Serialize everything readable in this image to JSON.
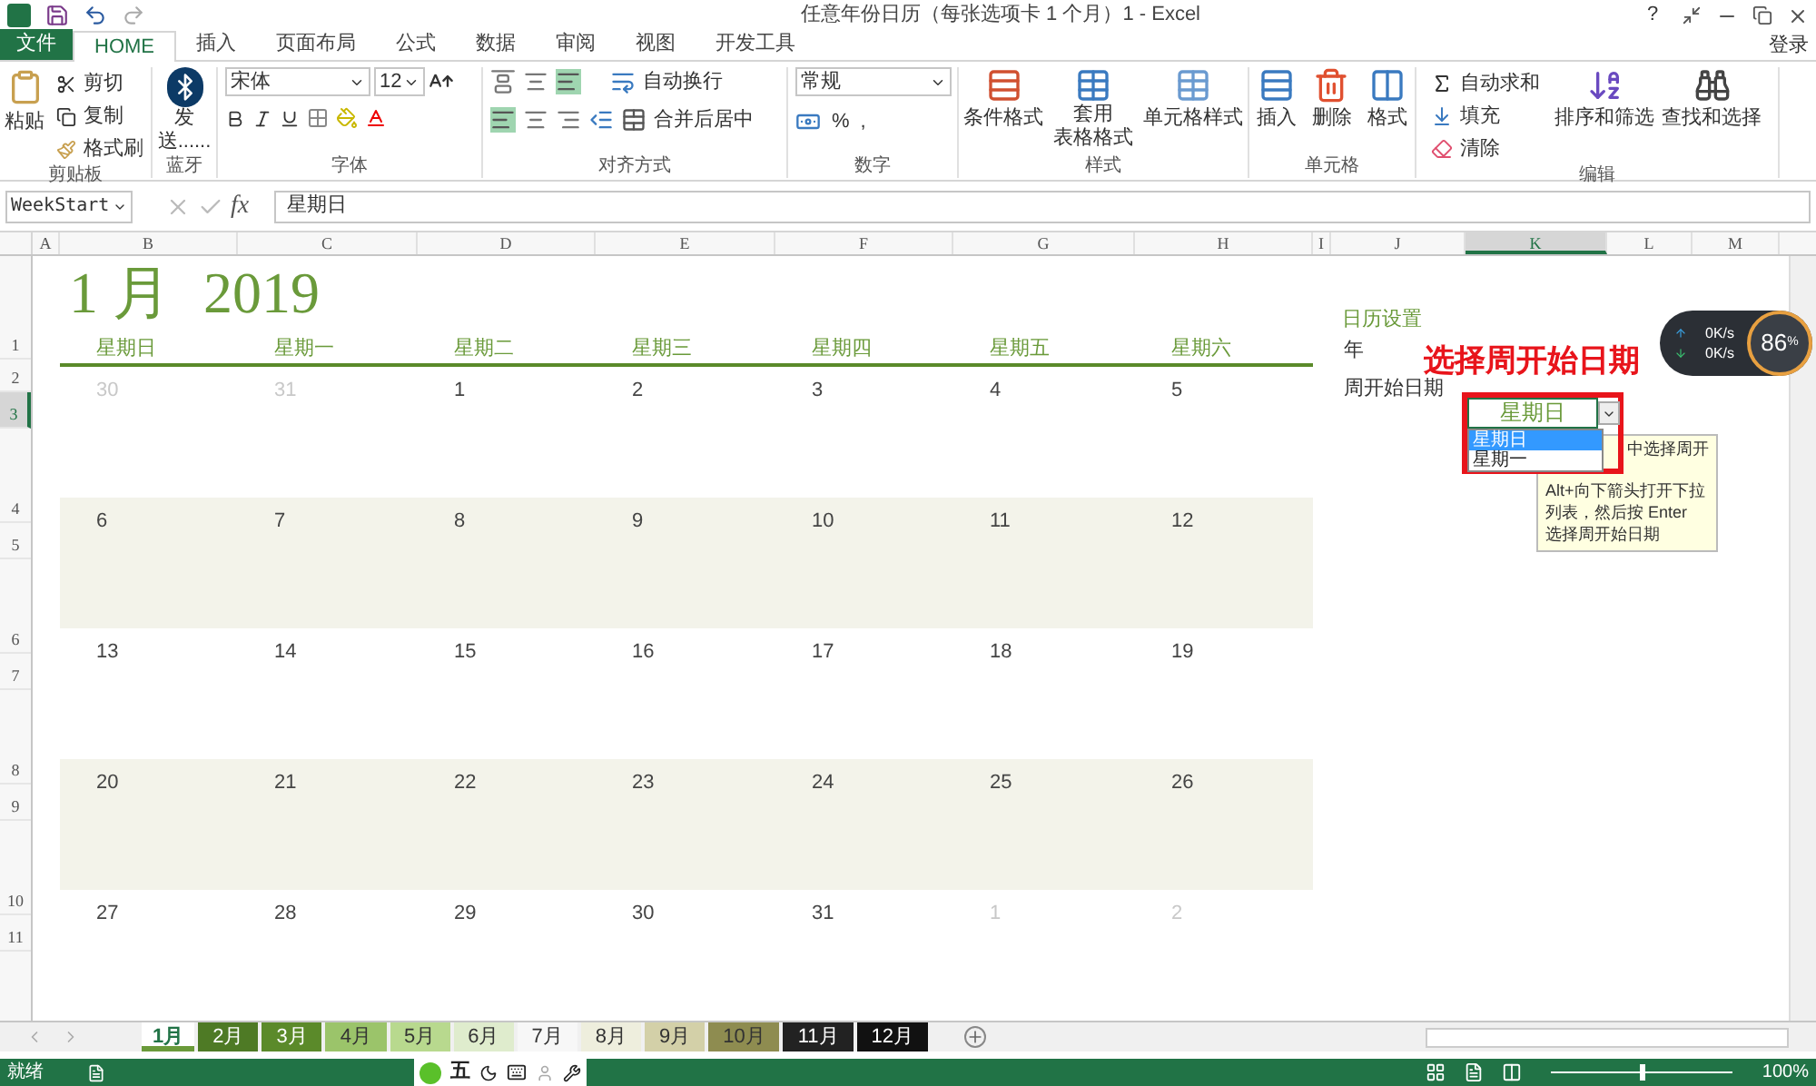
{
  "title_bar": {
    "title": "任意年份日历（每张选项卡 1 个月）1 - Excel",
    "help": "?"
  },
  "ribbon_tabs": [
    {
      "label": "文件",
      "kind": "file",
      "selected": false
    },
    {
      "label": "HOME",
      "kind": "tab",
      "selected": true
    },
    {
      "label": "插入",
      "kind": "tab",
      "selected": false
    },
    {
      "label": "页面布局",
      "kind": "tab",
      "selected": false
    },
    {
      "label": "公式",
      "kind": "tab",
      "selected": false
    },
    {
      "label": "数据",
      "kind": "tab",
      "selected": false
    },
    {
      "label": "审阅",
      "kind": "tab",
      "selected": false
    },
    {
      "label": "视图",
      "kind": "tab",
      "selected": false
    },
    {
      "label": "开发工具",
      "kind": "tab",
      "selected": false
    }
  ],
  "sign_in": "登录",
  "ribbon": {
    "clipboard": {
      "paste": "粘贴",
      "cut": "剪切",
      "copy": "复制",
      "painter": "格式刷",
      "label": "剪贴板"
    },
    "bluetooth": {
      "send": "发送......",
      "label": "蓝牙"
    },
    "font": {
      "name": "宋体",
      "size": "12",
      "label": "字体"
    },
    "alignment": {
      "wrap": "自动换行",
      "merge": "合并后居中",
      "label": "对齐方式"
    },
    "number": {
      "format": "常规",
      "percent": "%",
      "comma": ",",
      "label": "数字"
    },
    "styles": {
      "conditional": "条件格式",
      "table_1": "套用",
      "table_2": "表格格式",
      "cell": "单元格样式",
      "label": "样式"
    },
    "cells": {
      "insert": "插入",
      "delete": "删除",
      "format": "格式",
      "label": "单元格"
    },
    "editing": {
      "sum": "自动求和",
      "fill": "填充",
      "clear": "清除",
      "sort": "排序和筛选",
      "find": "查找和选择",
      "label": "编辑"
    }
  },
  "formula_bar": {
    "name_box": "WeekStart",
    "fx": "fx",
    "value": "星期日"
  },
  "columns": [
    {
      "label": "A",
      "selected": false
    },
    {
      "label": "B",
      "selected": false
    },
    {
      "label": "C",
      "selected": false
    },
    {
      "label": "D",
      "selected": false
    },
    {
      "label": "E",
      "selected": false
    },
    {
      "label": "F",
      "selected": false
    },
    {
      "label": "G",
      "selected": false
    },
    {
      "label": "H",
      "selected": false
    },
    {
      "label": "I",
      "selected": false
    },
    {
      "label": "J",
      "selected": false
    },
    {
      "label": "K",
      "selected": true
    },
    {
      "label": "L",
      "selected": false
    },
    {
      "label": "M",
      "selected": false
    }
  ],
  "row_numbers": [
    {
      "label": "1",
      "selected": false
    },
    {
      "label": "2",
      "selected": false
    },
    {
      "label": "3",
      "selected": true
    },
    {
      "label": "4",
      "selected": false
    },
    {
      "label": "5",
      "selected": false
    },
    {
      "label": "6",
      "selected": false
    },
    {
      "label": "7",
      "selected": false
    },
    {
      "label": "8",
      "selected": false
    },
    {
      "label": "9",
      "selected": false
    },
    {
      "label": "10",
      "selected": false
    },
    {
      "label": "11",
      "selected": false
    }
  ],
  "calendar": {
    "month": "1 月",
    "year": "2019",
    "weekdays": [
      "星期日",
      "星期一",
      "星期二",
      "星期三",
      "星期四",
      "星期五",
      "星期六"
    ],
    "weeks": [
      [
        {
          "day": "30",
          "other_month": true
        },
        {
          "day": "31",
          "other_month": true
        },
        {
          "day": "1",
          "other_month": false
        },
        {
          "day": "2",
          "other_month": false
        },
        {
          "day": "3",
          "other_month": false
        },
        {
          "day": "4",
          "other_month": false
        },
        {
          "day": "5",
          "other_month": false
        }
      ],
      [
        {
          "day": "6",
          "other_month": false
        },
        {
          "day": "7",
          "other_month": false
        },
        {
          "day": "8",
          "other_month": false
        },
        {
          "day": "9",
          "other_month": false
        },
        {
          "day": "10",
          "other_month": false
        },
        {
          "day": "11",
          "other_month": false
        },
        {
          "day": "12",
          "other_month": false
        }
      ],
      [
        {
          "day": "13",
          "other_month": false
        },
        {
          "day": "14",
          "other_month": false
        },
        {
          "day": "15",
          "other_month": false
        },
        {
          "day": "16",
          "other_month": false
        },
        {
          "day": "17",
          "other_month": false
        },
        {
          "day": "18",
          "other_month": false
        },
        {
          "day": "19",
          "other_month": false
        }
      ],
      [
        {
          "day": "20",
          "other_month": false
        },
        {
          "day": "21",
          "other_month": false
        },
        {
          "day": "22",
          "other_month": false
        },
        {
          "day": "23",
          "other_month": false
        },
        {
          "day": "24",
          "other_month": false
        },
        {
          "day": "25",
          "other_month": false
        },
        {
          "day": "26",
          "other_month": false
        }
      ],
      [
        {
          "day": "27",
          "other_month": false
        },
        {
          "day": "28",
          "other_month": false
        },
        {
          "day": "29",
          "other_month": false
        },
        {
          "day": "30",
          "other_month": false
        },
        {
          "day": "31",
          "other_month": false
        },
        {
          "day": "1",
          "other_month": true
        },
        {
          "day": "2",
          "other_month": true
        }
      ]
    ]
  },
  "settings": {
    "heading": "日历设置",
    "year_label": "年",
    "week_start_label": "周开始日期",
    "week_start_value": "星期日",
    "options": [
      {
        "label": "星期日",
        "selected": true
      },
      {
        "label": "星期一",
        "selected": false
      }
    ],
    "tooltip": [
      "中选择周开",
      "Alt+向下箭头打开下拉",
      "列表，然后按 Enter",
      "选择周开始日期"
    ]
  },
  "annotation": "选择周开始日期",
  "net_widget": {
    "up": "0K/s",
    "down": "0K/s",
    "percent": "86",
    "unit": "%"
  },
  "sheet_tabs": [
    {
      "label": "1月",
      "color": "#6a9a3a",
      "selected": true
    },
    {
      "label": "2月",
      "color": "#4e7a25",
      "selected": false
    },
    {
      "label": "3月",
      "color": "#5b8a2a",
      "selected": false
    },
    {
      "label": "4月",
      "color": "#9bc46a",
      "selected": false
    },
    {
      "label": "5月",
      "color": "#b8d98e",
      "selected": false
    },
    {
      "label": "6月",
      "color": "#dfeccd",
      "selected": false
    },
    {
      "label": "7月",
      "color": "#f7f7f7",
      "selected": false
    },
    {
      "label": "8月",
      "color": "#eeeedd",
      "selected": false
    },
    {
      "label": "9月",
      "color": "#d3d0a8",
      "selected": false
    },
    {
      "label": "10月",
      "color": "#8e8c50",
      "selected": false
    },
    {
      "label": "11月",
      "color": "#222222",
      "selected": false
    },
    {
      "label": "12月",
      "color": "#111111",
      "selected": false
    }
  ],
  "status_bar": {
    "status": "就绪",
    "ime": "五",
    "zoom": "100%",
    "zoom_slider": {
      "level": 0.5
    }
  }
}
